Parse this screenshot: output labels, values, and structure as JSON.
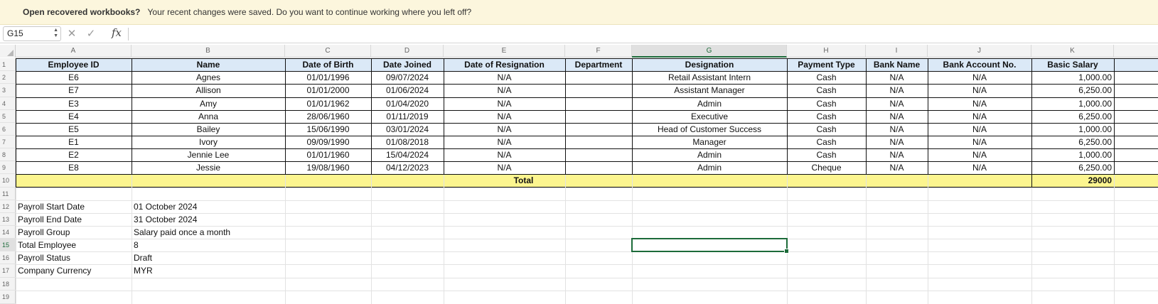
{
  "banner": {
    "title": "Open recovered workbooks?",
    "message": "Your recent changes were saved. Do you want to continue working where you left off?"
  },
  "formula_bar": {
    "name_box": "G15",
    "cancel_icon": "close-icon",
    "enter_icon": "checkmark-icon",
    "function_icon": "fx-icon",
    "formula": ""
  },
  "columns": [
    "A",
    "B",
    "C",
    "D",
    "E",
    "F",
    "G",
    "H",
    "I",
    "J",
    "K"
  ],
  "selected_column": "G",
  "rows": [
    "1",
    "2",
    "3",
    "4",
    "5",
    "6",
    "7",
    "8",
    "9",
    "10",
    "11",
    "12",
    "13",
    "14",
    "15",
    "16",
    "17",
    "18",
    "19"
  ],
  "selected_row": "15",
  "table": {
    "headers": [
      "Employee ID",
      "Name",
      "Date of Birth",
      "Date Joined",
      "Date of Resignation",
      "Department",
      "Designation",
      "Payment Type",
      "Bank Name",
      "Bank Account No.",
      "Basic Salary"
    ],
    "rows": [
      [
        "E6",
        "Agnes",
        "01/01/1996",
        "09/07/2024",
        "N/A",
        "",
        "Retail Assistant Intern",
        "Cash",
        "N/A",
        "N/A",
        "1,000.00"
      ],
      [
        "E7",
        "Allison",
        "01/01/2000",
        "01/06/2024",
        "N/A",
        "",
        "Assistant Manager",
        "Cash",
        "N/A",
        "N/A",
        "6,250.00"
      ],
      [
        "E3",
        "Amy",
        "01/01/1962",
        "01/04/2020",
        "N/A",
        "",
        "Admin",
        "Cash",
        "N/A",
        "N/A",
        "1,000.00"
      ],
      [
        "E4",
        "Anna",
        "28/06/1960",
        "01/11/2019",
        "N/A",
        "",
        "Executive",
        "Cash",
        "N/A",
        "N/A",
        "6,250.00"
      ],
      [
        "E5",
        "Bailey",
        "15/06/1990",
        "03/01/2024",
        "N/A",
        "",
        "Head of Customer Success",
        "Cash",
        "N/A",
        "N/A",
        "1,000.00"
      ],
      [
        "E1",
        "Ivory",
        "09/09/1990",
        "01/08/2018",
        "N/A",
        "",
        "Manager",
        "Cash",
        "N/A",
        "N/A",
        "6,250.00"
      ],
      [
        "E2",
        "Jennie Lee",
        "01/01/1960",
        "15/04/2024",
        "N/A",
        "",
        "Admin",
        "Cash",
        "N/A",
        "N/A",
        "1,000.00"
      ],
      [
        "E8",
        "Jessie",
        "19/08/1960",
        "04/12/2023",
        "N/A",
        "",
        "Admin",
        "Cheque",
        "N/A",
        "N/A",
        "6,250.00"
      ]
    ],
    "total_label": "Total",
    "total_value": "29000"
  },
  "summary": [
    {
      "label": "Payroll Start Date",
      "value": "01 October 2024"
    },
    {
      "label": "Payroll End Date",
      "value": "31 October 2024"
    },
    {
      "label": "Payroll Group",
      "value": "Salary paid once a month"
    },
    {
      "label": "Total Employee",
      "value": "8"
    },
    {
      "label": "Payroll Status",
      "value": "Draft"
    },
    {
      "label": "Company Currency",
      "value": "MYR"
    }
  ],
  "colors": {
    "header_fill": "#dbe9f7",
    "total_fill": "#fcf58f",
    "selection": "#1d6b3a",
    "banner": "#fcf6dd"
  }
}
